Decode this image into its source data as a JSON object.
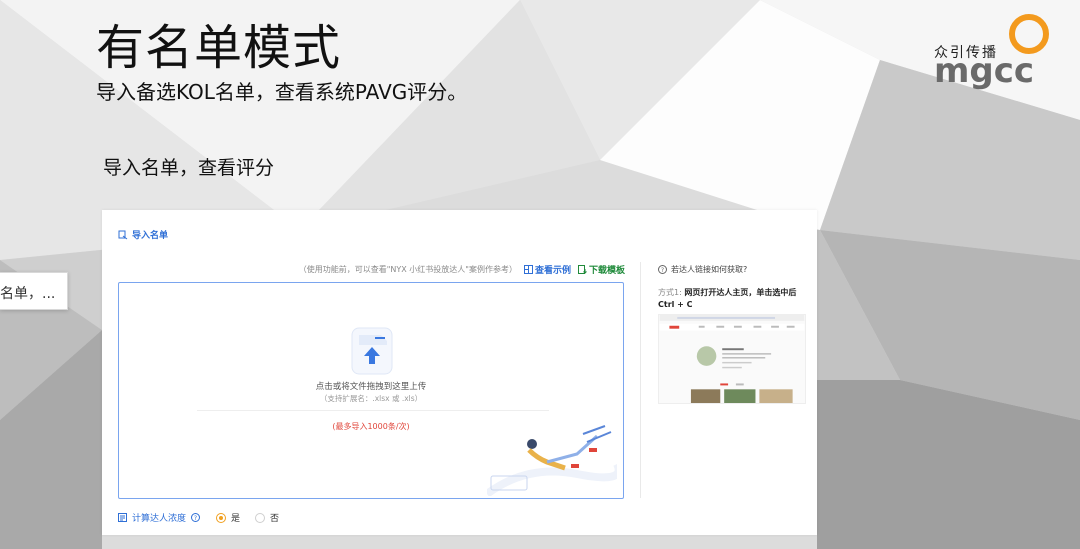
{
  "slide": {
    "title": "有名单模式",
    "subtitle": "导入备选KOL名单，查看系统PAVG评分。",
    "section_label": "导入名单，查看评分"
  },
  "logo": {
    "text": "众引传播",
    "wordmark": "mgcc",
    "ring_color": "#f39a1e"
  },
  "tooltip": {
    "text": "名单，..."
  },
  "panel": {
    "header": "导入名单",
    "hint": "（使用功能前，可以查看\"NYX 小红书投放达人\"案例作参考）",
    "view_example": "查看示例",
    "download_template": "下载模板",
    "dropzone": {
      "text": "点击或将文件拖拽到这里上传",
      "subtext": "（支持扩展名：.xlsx 或 .xls）",
      "limit": "(最多导入1000条/次)"
    },
    "side": {
      "question": "若达人链接如何获取?",
      "method_prefix": "方式1:",
      "method_text": "网页打开达人主页，单击选中后Ctrl + C"
    },
    "density": {
      "label": "计算达人浓度",
      "option_yes": "是",
      "option_no": "否",
      "selected": "是"
    }
  },
  "colors": {
    "accent_blue": "#2f6fd6",
    "accent_green": "#1f8a3a",
    "limit_red": "#e0453a",
    "radio_orange": "#f0a020",
    "dropzone_border": "#7aa5ef"
  }
}
